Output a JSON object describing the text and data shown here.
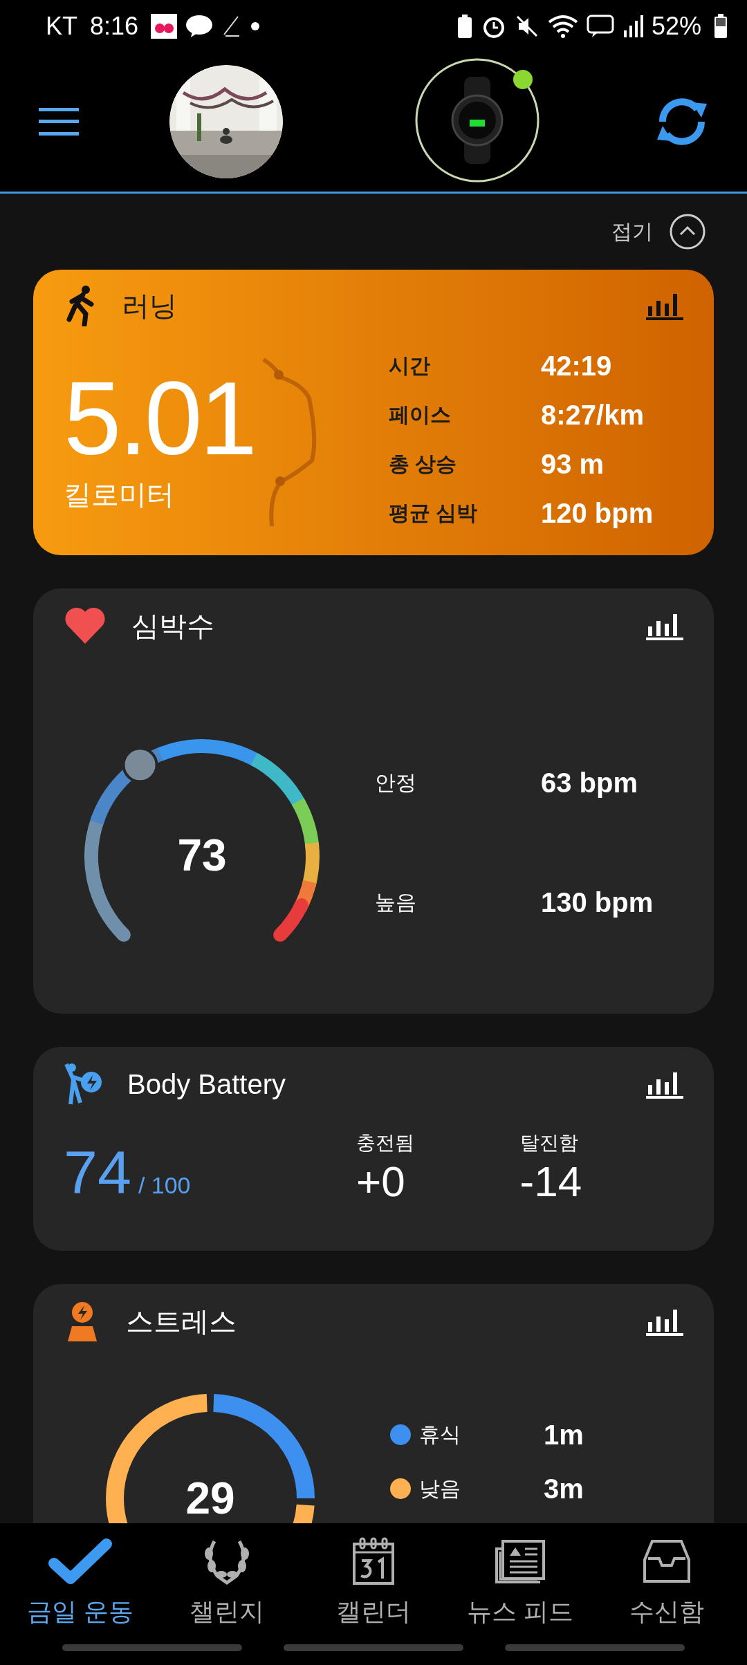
{
  "status_bar": {
    "carrier": "KT",
    "time": "8:16",
    "battery": "52%"
  },
  "header": {
    "collapse_label": "접기"
  },
  "running": {
    "title": "러닝",
    "distance": "5.01",
    "unit": "킬로미터",
    "stats": [
      {
        "label": "시간",
        "value": "42:19"
      },
      {
        "label": "페이스",
        "value": "8:27/km"
      },
      {
        "label": "총 상승",
        "value": "93 m"
      },
      {
        "label": "평균 심박",
        "value": "120 bpm"
      }
    ]
  },
  "heart_rate": {
    "title": "심박수",
    "current": "73",
    "stats": [
      {
        "label": "안정",
        "value": "63 bpm"
      },
      {
        "label": "높음",
        "value": "130 bpm"
      }
    ]
  },
  "body_battery": {
    "title": "Body Battery",
    "value": "74",
    "max": "/ 100",
    "stats": [
      {
        "label": "충전됨",
        "value": "+0"
      },
      {
        "label": "탈진함",
        "value": "-14"
      }
    ]
  },
  "stress": {
    "title": "스트레스",
    "value": "29",
    "legend": [
      {
        "label": "휴식",
        "value": "1m",
        "color": "#3d8ff0"
      },
      {
        "label": "낮음",
        "value": "3m",
        "color": "#ffb050"
      }
    ]
  },
  "nav": [
    {
      "label": "금일 운동",
      "kind": "check",
      "selected": true
    },
    {
      "label": "챌린지",
      "kind": "laurel",
      "selected": false
    },
    {
      "label": "캘린더",
      "kind": "calendar",
      "selected": false
    },
    {
      "label": "뉴스 피드",
      "kind": "news",
      "selected": false
    },
    {
      "label": "수신함",
      "kind": "inbox",
      "selected": false
    }
  ]
}
